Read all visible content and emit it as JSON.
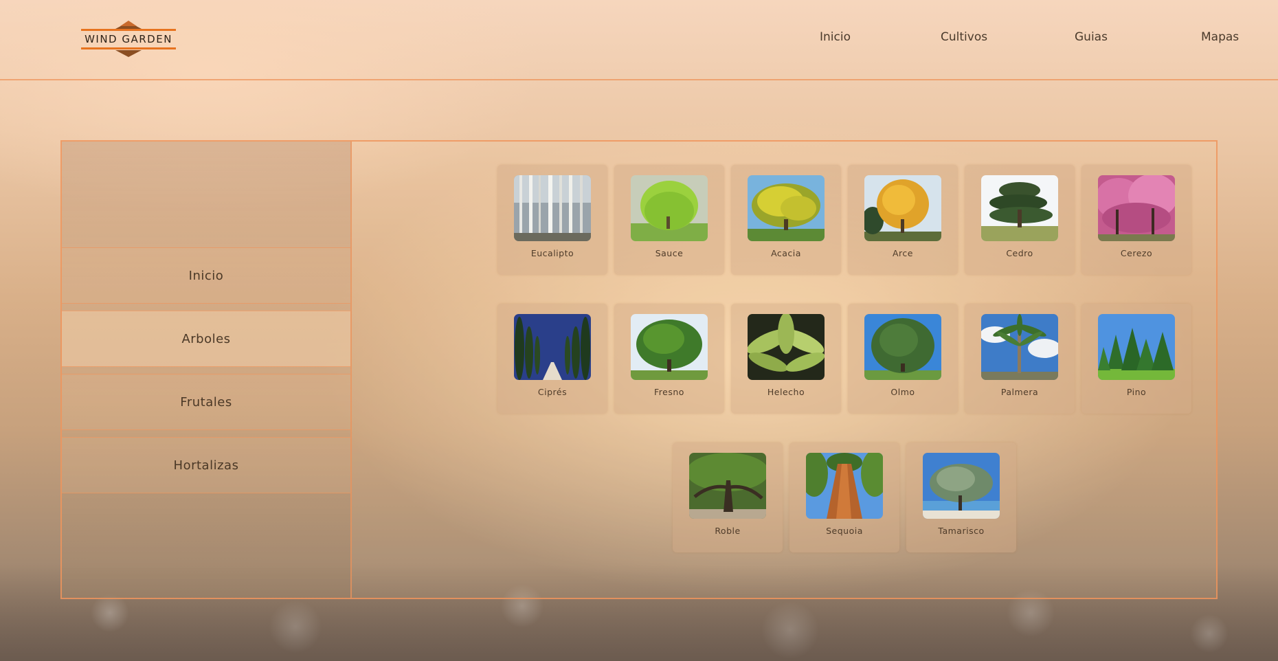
{
  "header": {
    "logo_text": "WIND GARDEN",
    "nav": [
      "Inicio",
      "Cultivos",
      "Guias",
      "Mapas"
    ]
  },
  "sidebar": {
    "items": [
      {
        "label": "Inicio",
        "active": false
      },
      {
        "label": "Arboles",
        "active": true
      },
      {
        "label": "Frutales",
        "active": false
      },
      {
        "label": "Hortalizas",
        "active": false
      }
    ]
  },
  "trees": [
    {
      "label": "Eucalipto",
      "icon": "eucalyptus-image"
    },
    {
      "label": "Sauce",
      "icon": "willow-image"
    },
    {
      "label": "Acacia",
      "icon": "acacia-image"
    },
    {
      "label": "Arce",
      "icon": "maple-image"
    },
    {
      "label": "Cedro",
      "icon": "cedar-image"
    },
    {
      "label": "Cerezo",
      "icon": "cherry-image"
    },
    {
      "label": "Ciprés",
      "icon": "cypress-image"
    },
    {
      "label": "Fresno",
      "icon": "ash-image"
    },
    {
      "label": "Helecho",
      "icon": "fern-image"
    },
    {
      "label": "Olmo",
      "icon": "elm-image"
    },
    {
      "label": "Palmera",
      "icon": "palm-image"
    },
    {
      "label": "Pino",
      "icon": "pine-image"
    },
    {
      "label": "Roble",
      "icon": "oak-image"
    },
    {
      "label": "Sequoia",
      "icon": "sequoia-image"
    },
    {
      "label": "Tamarisco",
      "icon": "tamarisk-image"
    }
  ],
  "colors": {
    "accent": "#e7731f",
    "border": "#ee945c"
  }
}
